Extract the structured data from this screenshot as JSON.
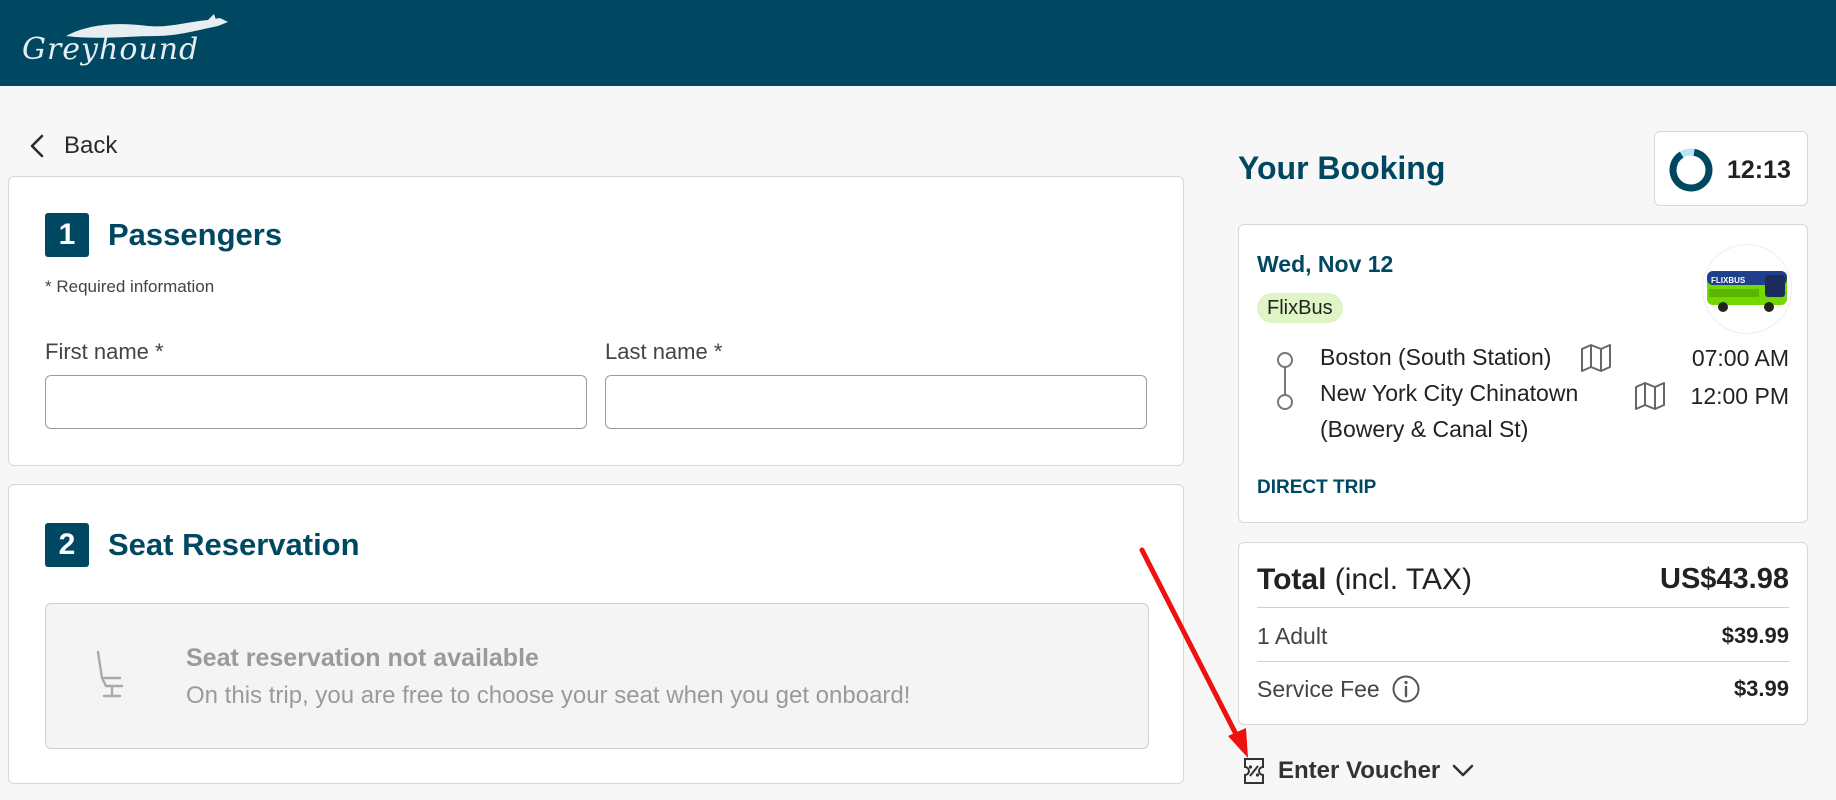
{
  "header": {
    "logo_text": "Greyhound"
  },
  "nav": {
    "back_label": "Back"
  },
  "passengers": {
    "step": "1",
    "title": "Passengers",
    "required_note": "* Required information",
    "first_name_label": "First name *",
    "first_name_value": "",
    "last_name_label": "Last name *",
    "last_name_value": ""
  },
  "seat": {
    "step": "2",
    "title": "Seat Reservation",
    "notice_title": "Seat reservation not available",
    "notice_text": "On this trip, you are free to choose your seat when you get onboard!"
  },
  "booking": {
    "title": "Your Booking",
    "timer": "12:13",
    "date": "Wed, Nov 12",
    "carrier": "FlixBus",
    "from_stop": "Boston (South Station)",
    "from_time": "07:00 AM",
    "to_stop_line1": "New York City Chinatown",
    "to_stop_line2": "(Bowery & Canal St)",
    "to_time": "12:00 PM",
    "trip_type": "DIRECT TRIP"
  },
  "price": {
    "total_label": "Total",
    "total_suffix": "(incl. TAX)",
    "total_value": "US$43.98",
    "adult_label": "1 Adult",
    "adult_value": "$39.99",
    "fee_label": "Service Fee",
    "fee_value": "$3.99"
  },
  "voucher": {
    "label": "Enter Voucher"
  },
  "colors": {
    "brand": "#004862",
    "badge": "#dff5c6",
    "annotation_arrow": "#ee1111"
  }
}
